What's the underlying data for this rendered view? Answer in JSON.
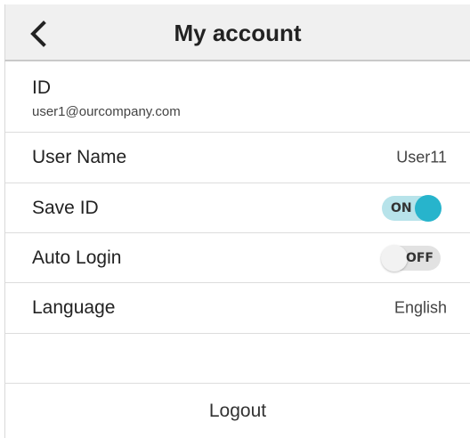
{
  "header": {
    "title": "My account",
    "back_icon": "chevron-left-icon"
  },
  "account": {
    "id_label": "ID",
    "id_value": "user1@ourcompany.com",
    "user_name_label": "User Name",
    "user_name_value": "User11",
    "save_id_label": "Save ID",
    "save_id_toggle": "ON",
    "auto_login_label": "Auto Login",
    "auto_login_toggle": "OFF",
    "language_label": "Language",
    "language_value": "English"
  },
  "footer": {
    "logout_label": "Logout"
  },
  "colors": {
    "accent": "#27b4cc",
    "accent_track": "#b7e3ea",
    "header_bg": "#f0f0f0"
  }
}
